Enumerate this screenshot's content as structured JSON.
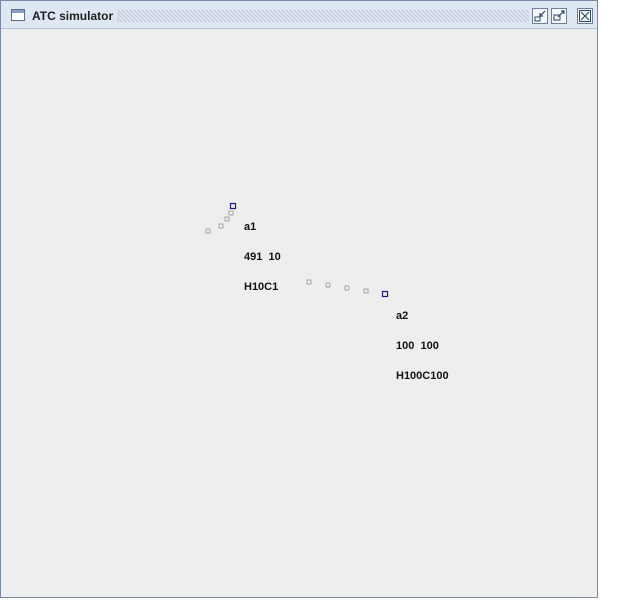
{
  "window": {
    "title": "ATC simulator",
    "icons": {
      "app": "window-icon",
      "minimize": "minimize-icon",
      "maximize": "maximize-icon",
      "close": "close-icon"
    },
    "colors": {
      "titlebar": "#dfe7f3",
      "background": "#eeeeee",
      "aircraft": "#1a1a8c",
      "trail": "#a7a7a7"
    }
  },
  "aircraft": [
    {
      "id": "a1",
      "line2": "491  10",
      "line3": "H10C1"
    },
    {
      "id": "a2",
      "line2": "100  100",
      "line3": "H100C100"
    }
  ]
}
